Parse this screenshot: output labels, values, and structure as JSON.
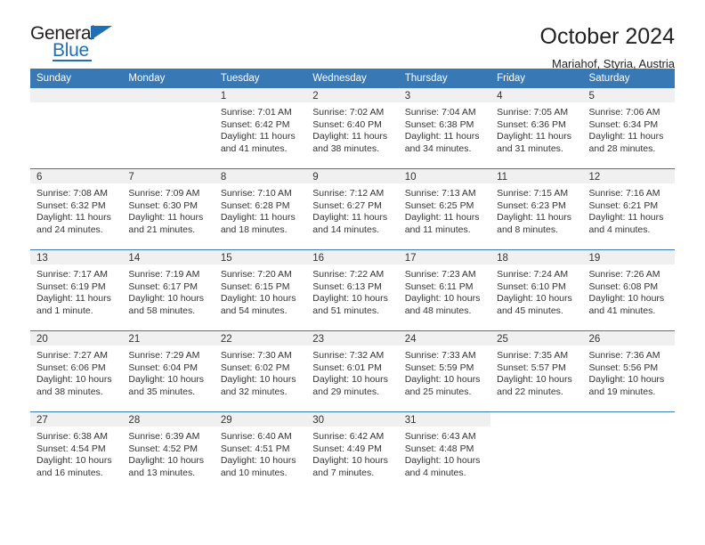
{
  "logo": {
    "word_top": "General",
    "word_bottom": "Blue",
    "triangle_color": "#1f6fb5"
  },
  "header": {
    "title": "October 2024",
    "subtitle": "Mariahof, Styria, Austria"
  },
  "theme": {
    "header_blue": "#3878b4",
    "daynum_gray": "#f0f0f0"
  },
  "calendar": {
    "weekday_headers": [
      "Sunday",
      "Monday",
      "Tuesday",
      "Wednesday",
      "Thursday",
      "Friday",
      "Saturday"
    ],
    "labels": {
      "sunrise": "Sunrise:",
      "sunset": "Sunset:",
      "daylight": "Daylight:"
    },
    "weeks": [
      [
        {
          "day": "",
          "blank": true
        },
        {
          "day": "",
          "blank": true
        },
        {
          "day": "1",
          "sunrise": "Sunrise: 7:01 AM",
          "sunset": "Sunset: 6:42 PM",
          "daylight": "Daylight: 11 hours and 41 minutes."
        },
        {
          "day": "2",
          "sunrise": "Sunrise: 7:02 AM",
          "sunset": "Sunset: 6:40 PM",
          "daylight": "Daylight: 11 hours and 38 minutes."
        },
        {
          "day": "3",
          "sunrise": "Sunrise: 7:04 AM",
          "sunset": "Sunset: 6:38 PM",
          "daylight": "Daylight: 11 hours and 34 minutes."
        },
        {
          "day": "4",
          "sunrise": "Sunrise: 7:05 AM",
          "sunset": "Sunset: 6:36 PM",
          "daylight": "Daylight: 11 hours and 31 minutes."
        },
        {
          "day": "5",
          "sunrise": "Sunrise: 7:06 AM",
          "sunset": "Sunset: 6:34 PM",
          "daylight": "Daylight: 11 hours and 28 minutes."
        }
      ],
      [
        {
          "day": "6",
          "sunrise": "Sunrise: 7:08 AM",
          "sunset": "Sunset: 6:32 PM",
          "daylight": "Daylight: 11 hours and 24 minutes."
        },
        {
          "day": "7",
          "sunrise": "Sunrise: 7:09 AM",
          "sunset": "Sunset: 6:30 PM",
          "daylight": "Daylight: 11 hours and 21 minutes."
        },
        {
          "day": "8",
          "sunrise": "Sunrise: 7:10 AM",
          "sunset": "Sunset: 6:28 PM",
          "daylight": "Daylight: 11 hours and 18 minutes."
        },
        {
          "day": "9",
          "sunrise": "Sunrise: 7:12 AM",
          "sunset": "Sunset: 6:27 PM",
          "daylight": "Daylight: 11 hours and 14 minutes."
        },
        {
          "day": "10",
          "sunrise": "Sunrise: 7:13 AM",
          "sunset": "Sunset: 6:25 PM",
          "daylight": "Daylight: 11 hours and 11 minutes."
        },
        {
          "day": "11",
          "sunrise": "Sunrise: 7:15 AM",
          "sunset": "Sunset: 6:23 PM",
          "daylight": "Daylight: 11 hours and 8 minutes."
        },
        {
          "day": "12",
          "sunrise": "Sunrise: 7:16 AM",
          "sunset": "Sunset: 6:21 PM",
          "daylight": "Daylight: 11 hours and 4 minutes."
        }
      ],
      [
        {
          "day": "13",
          "sunrise": "Sunrise: 7:17 AM",
          "sunset": "Sunset: 6:19 PM",
          "daylight": "Daylight: 11 hours and 1 minute."
        },
        {
          "day": "14",
          "sunrise": "Sunrise: 7:19 AM",
          "sunset": "Sunset: 6:17 PM",
          "daylight": "Daylight: 10 hours and 58 minutes."
        },
        {
          "day": "15",
          "sunrise": "Sunrise: 7:20 AM",
          "sunset": "Sunset: 6:15 PM",
          "daylight": "Daylight: 10 hours and 54 minutes."
        },
        {
          "day": "16",
          "sunrise": "Sunrise: 7:22 AM",
          "sunset": "Sunset: 6:13 PM",
          "daylight": "Daylight: 10 hours and 51 minutes."
        },
        {
          "day": "17",
          "sunrise": "Sunrise: 7:23 AM",
          "sunset": "Sunset: 6:11 PM",
          "daylight": "Daylight: 10 hours and 48 minutes."
        },
        {
          "day": "18",
          "sunrise": "Sunrise: 7:24 AM",
          "sunset": "Sunset: 6:10 PM",
          "daylight": "Daylight: 10 hours and 45 minutes."
        },
        {
          "day": "19",
          "sunrise": "Sunrise: 7:26 AM",
          "sunset": "Sunset: 6:08 PM",
          "daylight": "Daylight: 10 hours and 41 minutes."
        }
      ],
      [
        {
          "day": "20",
          "sunrise": "Sunrise: 7:27 AM",
          "sunset": "Sunset: 6:06 PM",
          "daylight": "Daylight: 10 hours and 38 minutes."
        },
        {
          "day": "21",
          "sunrise": "Sunrise: 7:29 AM",
          "sunset": "Sunset: 6:04 PM",
          "daylight": "Daylight: 10 hours and 35 minutes."
        },
        {
          "day": "22",
          "sunrise": "Sunrise: 7:30 AM",
          "sunset": "Sunset: 6:02 PM",
          "daylight": "Daylight: 10 hours and 32 minutes."
        },
        {
          "day": "23",
          "sunrise": "Sunrise: 7:32 AM",
          "sunset": "Sunset: 6:01 PM",
          "daylight": "Daylight: 10 hours and 29 minutes."
        },
        {
          "day": "24",
          "sunrise": "Sunrise: 7:33 AM",
          "sunset": "Sunset: 5:59 PM",
          "daylight": "Daylight: 10 hours and 25 minutes."
        },
        {
          "day": "25",
          "sunrise": "Sunrise: 7:35 AM",
          "sunset": "Sunset: 5:57 PM",
          "daylight": "Daylight: 10 hours and 22 minutes."
        },
        {
          "day": "26",
          "sunrise": "Sunrise: 7:36 AM",
          "sunset": "Sunset: 5:56 PM",
          "daylight": "Daylight: 10 hours and 19 minutes."
        }
      ],
      [
        {
          "day": "27",
          "sunrise": "Sunrise: 6:38 AM",
          "sunset": "Sunset: 4:54 PM",
          "daylight": "Daylight: 10 hours and 16 minutes."
        },
        {
          "day": "28",
          "sunrise": "Sunrise: 6:39 AM",
          "sunset": "Sunset: 4:52 PM",
          "daylight": "Daylight: 10 hours and 13 minutes."
        },
        {
          "day": "29",
          "sunrise": "Sunrise: 6:40 AM",
          "sunset": "Sunset: 4:51 PM",
          "daylight": "Daylight: 10 hours and 10 minutes."
        },
        {
          "day": "30",
          "sunrise": "Sunrise: 6:42 AM",
          "sunset": "Sunset: 4:49 PM",
          "daylight": "Daylight: 10 hours and 7 minutes."
        },
        {
          "day": "31",
          "sunrise": "Sunrise: 6:43 AM",
          "sunset": "Sunset: 4:48 PM",
          "daylight": "Daylight: 10 hours and 4 minutes."
        },
        {
          "day": "",
          "outside": true
        },
        {
          "day": "",
          "outside": true
        }
      ]
    ]
  }
}
